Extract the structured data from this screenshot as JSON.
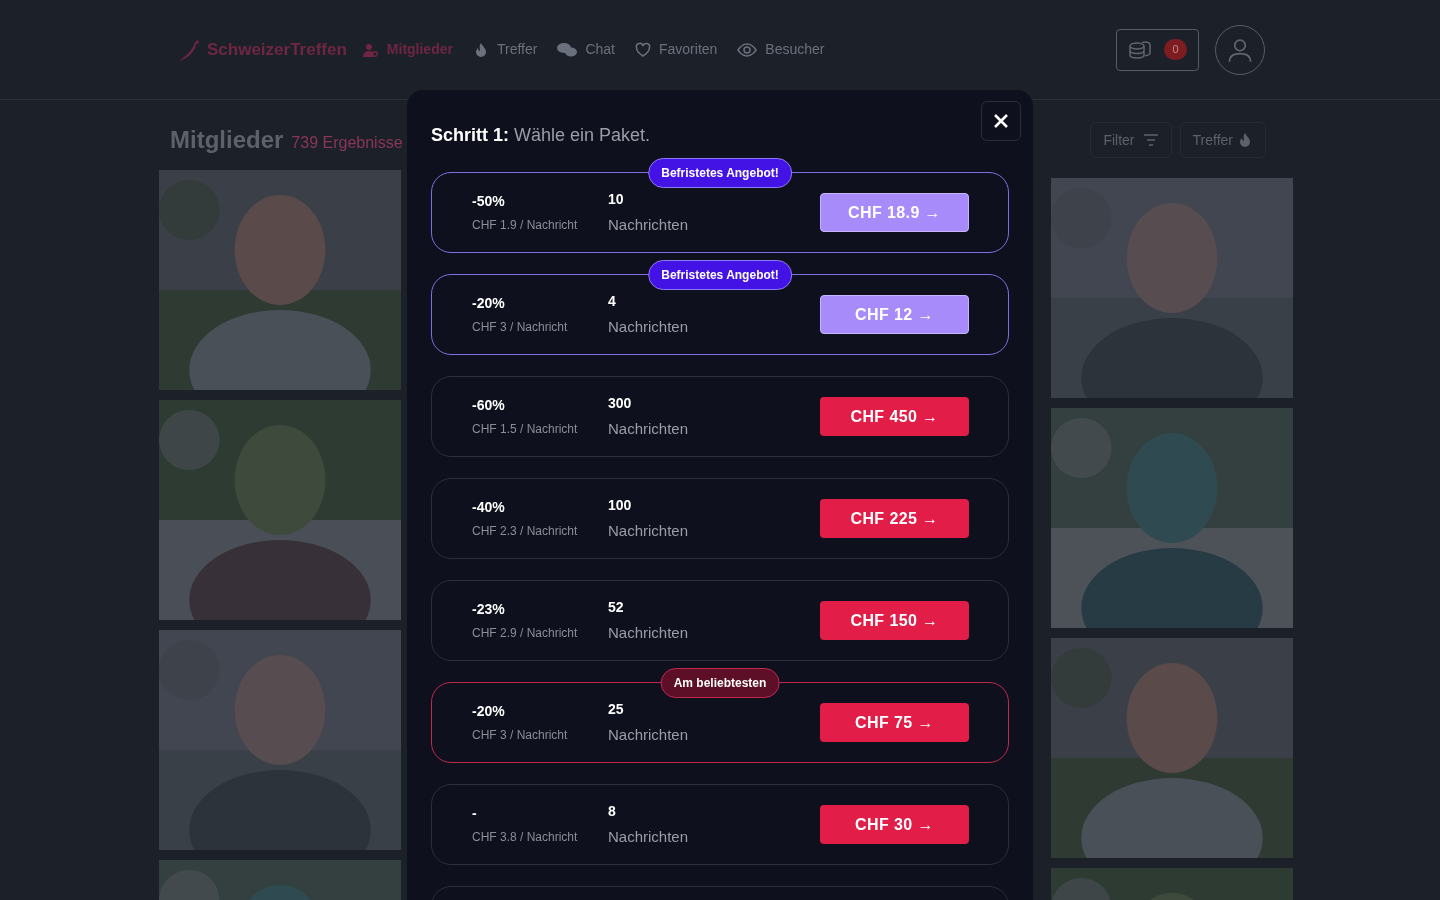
{
  "header": {
    "logo": "SchweizerTreffen",
    "nav": [
      {
        "label": "Mitglieder",
        "selected": true
      },
      {
        "label": "Treffer",
        "selected": false
      },
      {
        "label": "Chat",
        "selected": false
      },
      {
        "label": "Favoriten",
        "selected": false
      },
      {
        "label": "Besucher",
        "selected": false
      }
    ],
    "coins": "0"
  },
  "page": {
    "title": "Mitglieder",
    "results": "739 Ergebnisse",
    "filter": "Filter",
    "matches": "Treffer"
  },
  "modal": {
    "step": "Schritt 1:",
    "title": "Wähle ein Paket.",
    "packages": [
      {
        "kind": "limited",
        "badge": "Befristetes Angebot!",
        "discount": "-50%",
        "per_message": "CHF 1.9 / Nachricht",
        "count": "10",
        "unit": "Nachrichten",
        "price": "CHF 18.9 →"
      },
      {
        "kind": "limited",
        "badge": "Befristetes Angebot!",
        "discount": "-20%",
        "per_message": "CHF 3 / Nachricht",
        "count": "4",
        "unit": "Nachrichten",
        "price": "CHF 12 →"
      },
      {
        "kind": "standard",
        "discount": "-60%",
        "per_message": "CHF 1.5 / Nachricht",
        "count": "300",
        "unit": "Nachrichten",
        "price": "CHF 450 →"
      },
      {
        "kind": "standard",
        "discount": "-40%",
        "per_message": "CHF 2.3 / Nachricht",
        "count": "100",
        "unit": "Nachrichten",
        "price": "CHF 225 →"
      },
      {
        "kind": "standard",
        "discount": "-23%",
        "per_message": "CHF 2.9 / Nachricht",
        "count": "52",
        "unit": "Nachrichten",
        "price": "CHF 150 →"
      },
      {
        "kind": "popular",
        "badge": "Am beliebtesten",
        "discount": "-20%",
        "per_message": "CHF 3 / Nachricht",
        "count": "25",
        "unit": "Nachrichten",
        "price": "CHF 75 →"
      },
      {
        "kind": "standard",
        "discount": "-",
        "per_message": "CHF 3.8 / Nachricht",
        "count": "8",
        "unit": "Nachrichten",
        "price": "CHF 30 →"
      }
    ]
  }
}
